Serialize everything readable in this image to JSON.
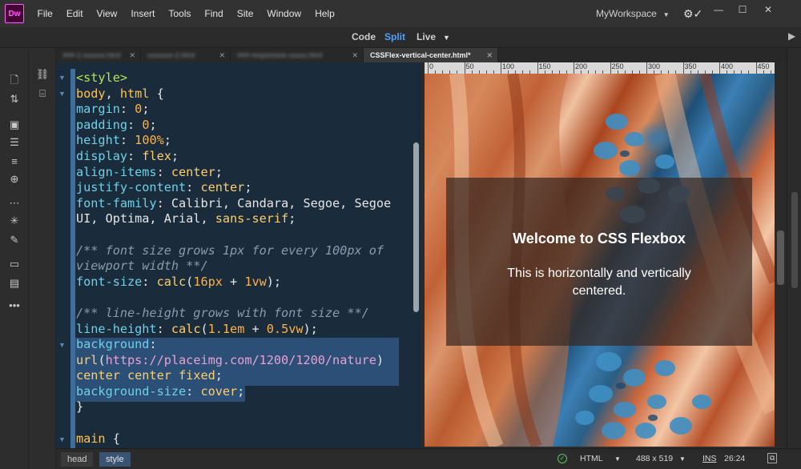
{
  "app": {
    "logo": "Dw",
    "workspace": "MyWorkspace"
  },
  "menu": [
    "File",
    "Edit",
    "View",
    "Insert",
    "Tools",
    "Find",
    "Site",
    "Window",
    "Help"
  ],
  "view_modes": {
    "code": "Code",
    "split": "Split",
    "live": "Live",
    "active": "Split"
  },
  "tabs": [
    {
      "label": "###-1-xxxxxx.html",
      "active": false
    },
    {
      "label": "xxxxxxx-2.html",
      "active": false
    },
    {
      "label": "###-responsive-xxxxx.html",
      "active": false
    },
    {
      "label": "CSSFlex-vertical-center.html*",
      "active": true
    }
  ],
  "code_lines": [
    [
      [
        "tag",
        "<style>"
      ]
    ],
    [
      [
        "sel",
        "body"
      ],
      [
        "pun",
        ", "
      ],
      [
        "sel",
        "html"
      ],
      [
        "pun",
        " {"
      ]
    ],
    [
      [
        "prop",
        "margin"
      ],
      [
        "pun",
        ": "
      ],
      [
        "num",
        "0"
      ],
      [
        "pun",
        ";"
      ]
    ],
    [
      [
        "prop",
        "padding"
      ],
      [
        "pun",
        ": "
      ],
      [
        "num",
        "0"
      ],
      [
        "pun",
        ";"
      ]
    ],
    [
      [
        "prop",
        "height"
      ],
      [
        "pun",
        ": "
      ],
      [
        "num",
        "100%"
      ],
      [
        "pun",
        ";"
      ]
    ],
    [
      [
        "prop",
        "display"
      ],
      [
        "pun",
        ": "
      ],
      [
        "val",
        "flex"
      ],
      [
        "pun",
        ";"
      ]
    ],
    [
      [
        "prop",
        "align-items"
      ],
      [
        "pun",
        ": "
      ],
      [
        "val",
        "center"
      ],
      [
        "pun",
        ";"
      ]
    ],
    [
      [
        "prop",
        "justify-content"
      ],
      [
        "pun",
        ": "
      ],
      [
        "val",
        "center"
      ],
      [
        "pun",
        ";"
      ]
    ],
    [
      [
        "prop",
        "font-family"
      ],
      [
        "pun",
        ": Calibri, Candara, Segoe, Segoe"
      ]
    ],
    [
      [
        "pun",
        "UI, Optima, Arial, "
      ],
      [
        "val",
        "sans-serif"
      ],
      [
        "pun",
        ";"
      ]
    ],
    [
      [
        "pun",
        ""
      ]
    ],
    [
      [
        "cmt",
        "/** font size grows 1px for every 100px of"
      ]
    ],
    [
      [
        "cmt",
        "viewport width **/"
      ]
    ],
    [
      [
        "prop",
        "font-size"
      ],
      [
        "pun",
        ": "
      ],
      [
        "val",
        "calc"
      ],
      [
        "pun",
        "("
      ],
      [
        "num",
        "16px"
      ],
      [
        "pun",
        " + "
      ],
      [
        "num",
        "1vw"
      ],
      [
        "pun",
        ");"
      ]
    ],
    [
      [
        "pun",
        ""
      ]
    ],
    [
      [
        "cmt",
        "/** line-height grows with font size **/"
      ]
    ],
    [
      [
        "prop",
        "line-height"
      ],
      [
        "pun",
        ": "
      ],
      [
        "val",
        "calc"
      ],
      [
        "pun",
        "("
      ],
      [
        "num",
        "1.1em"
      ],
      [
        "pun",
        " + "
      ],
      [
        "num",
        "0.5vw"
      ],
      [
        "pun",
        ");"
      ]
    ],
    [
      [
        "prop",
        "background"
      ],
      [
        "pun",
        ":"
      ]
    ],
    [
      [
        "val",
        "url"
      ],
      [
        "pun",
        "("
      ],
      [
        "url",
        "https://placeimg.com/1200/1200/nature"
      ],
      [
        "pun",
        ")"
      ]
    ],
    [
      [
        "val",
        "center center fixed"
      ],
      [
        "pun",
        ";"
      ]
    ],
    [
      [
        "prop",
        "background-size"
      ],
      [
        "pun",
        ": "
      ],
      [
        "val",
        "cover"
      ],
      [
        "pun",
        ";"
      ]
    ],
    [
      [
        "pun",
        "}"
      ]
    ],
    [
      [
        "pun",
        ""
      ]
    ],
    [
      [
        "sel",
        "main"
      ],
      [
        "pun",
        " {"
      ]
    ]
  ],
  "ruler": [
    "0",
    "50",
    "100",
    "150",
    "200",
    "250",
    "300",
    "350",
    "400",
    "450"
  ],
  "live": {
    "heading": "Welcome to CSS Flexbox",
    "text": "This is horizontally and vertically centered."
  },
  "status": {
    "crumbs": [
      "head",
      "style"
    ],
    "doc_type": "HTML",
    "dimensions": "488 x 519",
    "mode": "INS",
    "position": "26:24"
  }
}
